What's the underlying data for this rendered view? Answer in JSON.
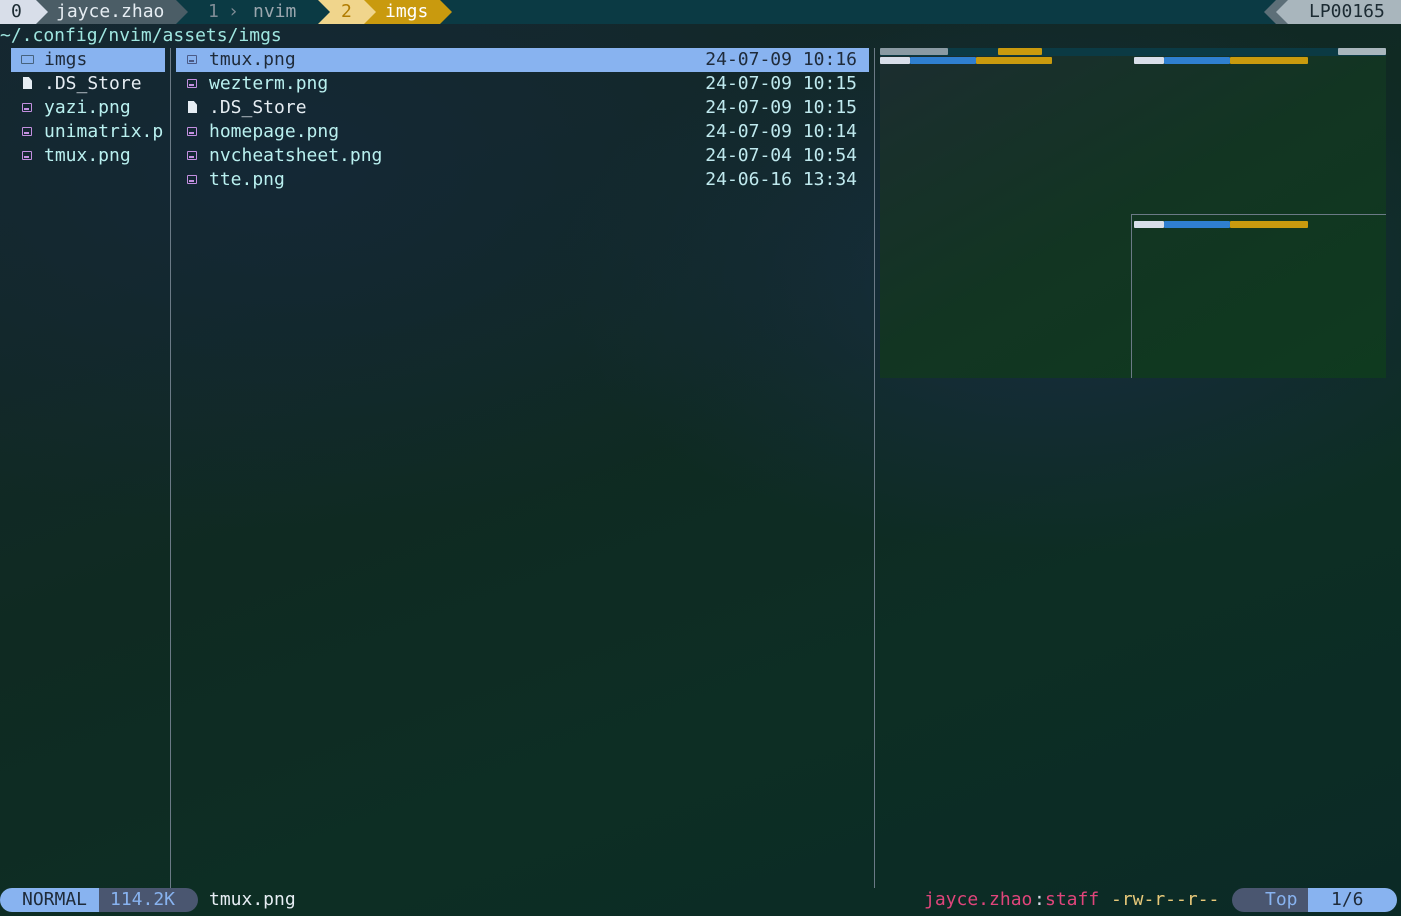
{
  "tmux": {
    "session_index": "0",
    "session_name": "jayce.zhao",
    "windows": [
      {
        "index": "1",
        "name": "nvim"
      },
      {
        "index": "2",
        "name": "imgs"
      }
    ],
    "host": "LP00165"
  },
  "cwd": "~/.config/nvim/assets/imgs",
  "parent_pane": {
    "items": [
      {
        "name": "imgs",
        "icon": "folder-icon",
        "selected": true
      },
      {
        "name": ".DS_Store",
        "icon": "file-icon"
      },
      {
        "name": "yazi.png",
        "icon": "image-icon"
      },
      {
        "name": "unimatrix.p",
        "icon": "image-icon"
      },
      {
        "name": "tmux.png",
        "icon": "image-icon"
      }
    ]
  },
  "current_pane": {
    "items": [
      {
        "name": "tmux.png",
        "date": "24-07-09 10:16",
        "icon": "image-icon",
        "selected": true
      },
      {
        "name": "wezterm.png",
        "date": "24-07-09 10:15",
        "icon": "image-icon"
      },
      {
        "name": ".DS_Store",
        "date": "24-07-09 10:15",
        "icon": "file-icon"
      },
      {
        "name": "homepage.png",
        "date": "24-07-09 10:14",
        "icon": "image-icon"
      },
      {
        "name": "nvcheatsheet.png",
        "date": "24-07-04 10:54",
        "icon": "image-icon"
      },
      {
        "name": "tte.png",
        "date": "24-06-16 13:34",
        "icon": "image-icon"
      }
    ]
  },
  "status": {
    "mode": "NORMAL",
    "size": "114.2K",
    "filename": "tmux.png",
    "owner": "jayce.zhao",
    "group": "staff",
    "permissions": "-rw-r--r--",
    "position": "Top",
    "count": "1/6"
  },
  "colors": {
    "selected_row": "#88b3f0",
    "active_window": "#c99a0e",
    "owner": "#e0457b",
    "group": "#e0457b"
  }
}
